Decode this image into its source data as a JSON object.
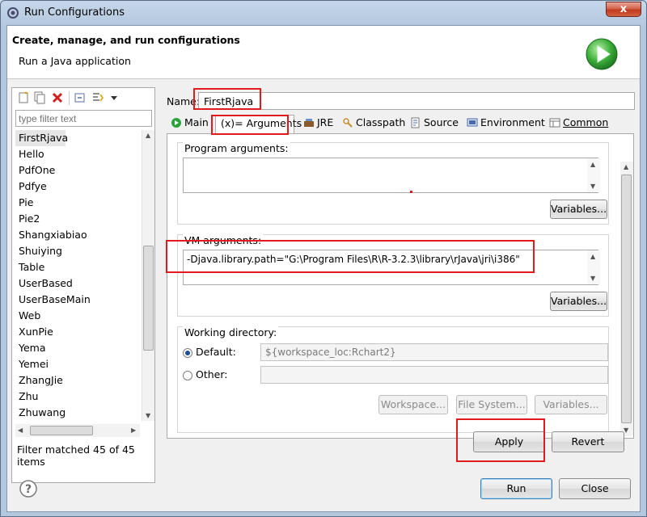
{
  "window": {
    "title": "Run Configurations",
    "close_label": "x"
  },
  "header": {
    "title": "Create, manage, and run configurations",
    "subtitle": "Run a Java application"
  },
  "filter": {
    "placeholder": "type filter text"
  },
  "configurations": [
    "FirstRjava",
    "Hello",
    "PdfOne",
    "Pdfye",
    "Pie",
    "Pie2",
    "Shangxiabiao",
    "Shuiying",
    "Table",
    "UserBased",
    "UserBaseMain",
    "Web",
    "XunPie",
    "Yema",
    "Yemei",
    "ZhangJie",
    "Zhu",
    "Zhuwang"
  ],
  "filter_status": "Filter matched 45 of 45 items",
  "name": {
    "label": "Name:",
    "value": "FirstRjava"
  },
  "tabs": [
    {
      "label": "Main",
      "icon": "main-icon"
    },
    {
      "label": "(x)= Arguments",
      "icon": "arguments-icon"
    },
    {
      "label": "JRE",
      "icon": "jre-icon"
    },
    {
      "label": "Classpath",
      "icon": "classpath-icon"
    },
    {
      "label": "Source",
      "icon": "source-icon"
    },
    {
      "label": "Environment",
      "icon": "environment-icon"
    },
    {
      "label": "Common",
      "icon": "common-icon"
    }
  ],
  "program_args": {
    "label": "Program arguments:",
    "value": "",
    "variables_label": "Variables..."
  },
  "vm_args": {
    "label": "VM arguments:",
    "value": "-Djava.library.path=\"G:\\Program Files\\R\\R-3.2.3\\library\\rJava\\jri\\i386\"",
    "variables_label": "Variables..."
  },
  "working_dir": {
    "label": "Working directory:",
    "default_label": "Default:",
    "default_value": "${workspace_loc:Rchart2}",
    "other_label": "Other:",
    "other_value": "",
    "workspace_label": "Workspace...",
    "filesystem_label": "File System...",
    "variables_label": "Variables..."
  },
  "actions": {
    "apply": "Apply",
    "revert": "Revert",
    "run": "Run",
    "close": "Close"
  },
  "colors": {
    "highlight": "#e11b1b",
    "run_green": "#2aa43a"
  }
}
